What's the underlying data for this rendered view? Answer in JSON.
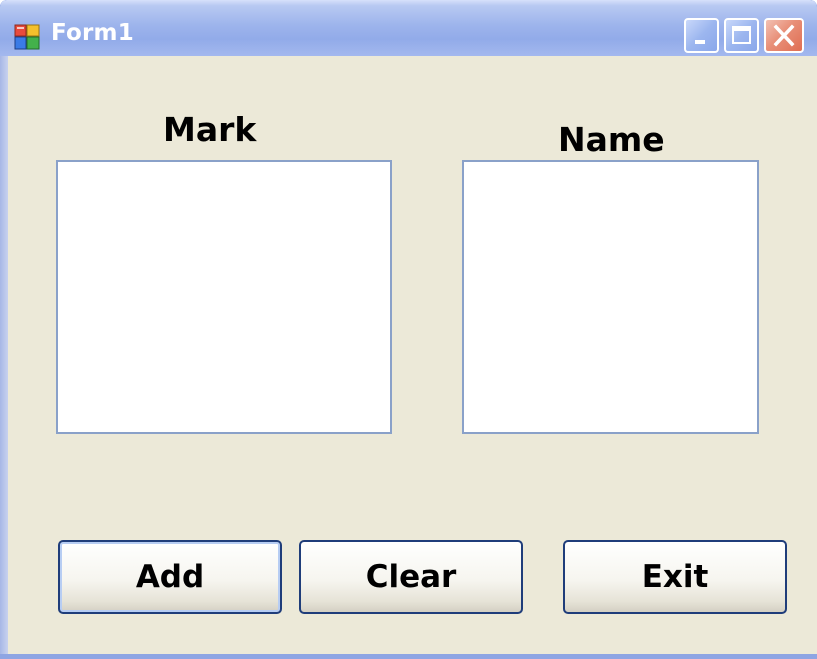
{
  "window": {
    "title": "Form1",
    "app_icon": "form-app-icon",
    "controls": {
      "minimize_icon": "minimize-icon",
      "maximize_icon": "maximize-icon",
      "close_icon": "close-icon"
    }
  },
  "form": {
    "mark_label": "Mark",
    "name_label": "Name",
    "mark_list_items": [],
    "name_list_items": []
  },
  "buttons": {
    "add_label": "Add",
    "clear_label": "Clear",
    "exit_label": "Exit"
  },
  "colors": {
    "client_background": "#ece9d8",
    "title_text": "#ffffff",
    "button_border": "#1f3d7a",
    "listbox_border": "#8aa1c9"
  }
}
